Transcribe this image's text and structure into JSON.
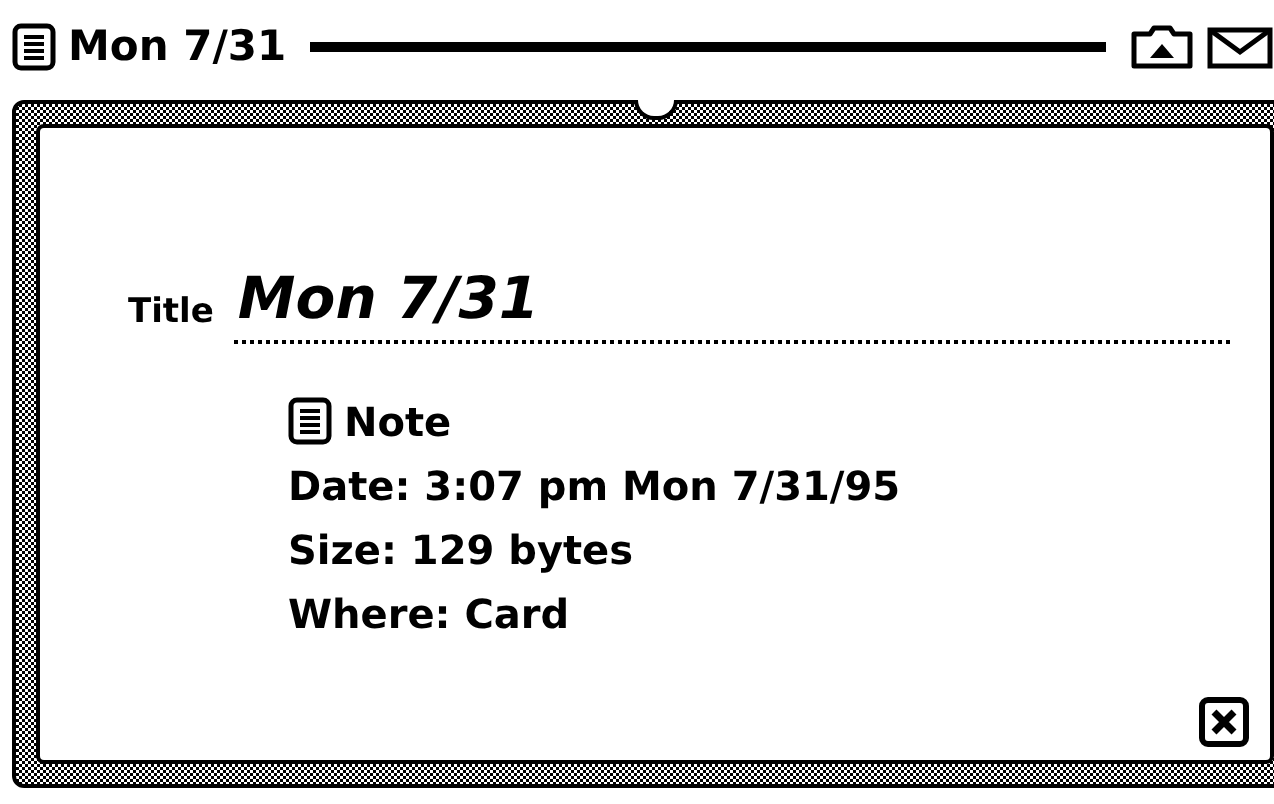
{
  "header": {
    "title": "Mon 7/31"
  },
  "info_slip": {
    "title_label": "Title",
    "title_value": "Mon 7/31",
    "item_type": "Note",
    "details": [
      "Date: 3:07 pm Mon 7/31/95",
      "Size: 129 bytes",
      "Where: Card"
    ]
  }
}
